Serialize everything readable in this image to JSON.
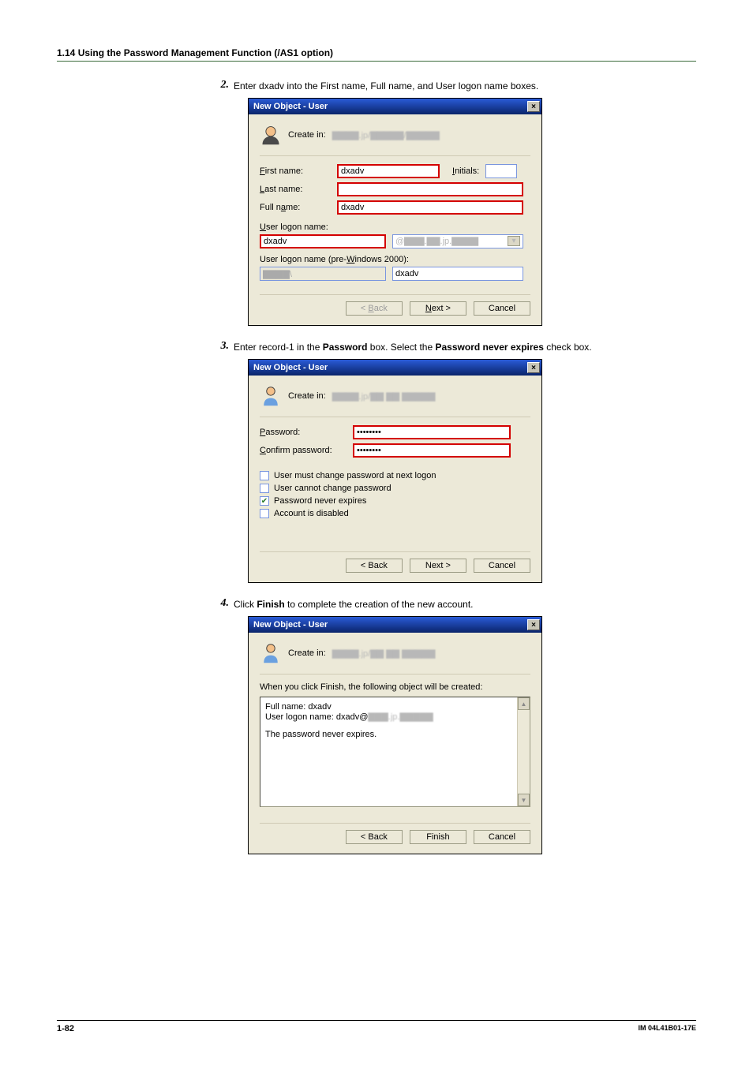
{
  "heading": "1.14  Using the Password Management Function (/AS1 option)",
  "steps": {
    "s2": {
      "num": "2.",
      "text": "Enter dxadv into the First name, Full name, and User logon name boxes."
    },
    "s3": {
      "num": "3.",
      "text_pre": "Enter record-1 in the ",
      "bold1": "Password",
      "mid": " box. Select the ",
      "bold2": "Password never expires",
      "text_post": " check box."
    },
    "s4": {
      "num": "4.",
      "text_pre": "Click ",
      "bold1": "Finish",
      "text_post": " to complete the creation of the new account."
    }
  },
  "dialog1": {
    "title": "New Object - User",
    "create_in_label": "Create in:",
    "create_in_path": "▇▇▇▇.jp/▇▇▇▇▇/▇▇▇▇▇",
    "first_name_label": "First name:",
    "first_name_value": "dxadv",
    "initials_label": "Initials:",
    "last_name_label": "Last name:",
    "full_name_label": "Full name:",
    "full_name_value": "dxadv",
    "user_logon_label": "User logon name:",
    "user_logon_value": "dxadv",
    "domain_value": "@▇▇▇.▇▇.jp.▇▇▇▇",
    "pre2000_label": "User logon name (pre-Windows 2000):",
    "pre2000_prefix": "▇▇▇▇\\",
    "pre2000_value": "dxadv",
    "btn_back": "< Back",
    "btn_next": "Next >",
    "btn_cancel": "Cancel"
  },
  "dialog2": {
    "title": "New Object - User",
    "create_in_label": "Create in:",
    "create_in_path": "▇▇▇▇.jp/▇▇ ▇▇ ▇▇▇▇▇",
    "password_label": "Password:",
    "password_value": "••••••••",
    "confirm_label": "Confirm password:",
    "confirm_value": "••••••••",
    "chk_mustchange": "User must change password at next logon",
    "chk_cannot": "User cannot change password",
    "chk_never": "Password never expires",
    "chk_disabled": "Account is disabled",
    "btn_back": "< Back",
    "btn_next": "Next >",
    "btn_cancel": "Cancel"
  },
  "dialog3": {
    "title": "New Object - User",
    "create_in_label": "Create in:",
    "create_in_path": "▇▇▇▇.jp/▇▇ ▇▇ ▇▇▇▇▇",
    "intro": "When you click Finish, the following object will be created:",
    "line1": "Full name: dxadv",
    "line2_pre": "User logon name: dxadv@",
    "line2_dom": "▇▇▇.jp.▇▇▇▇▇",
    "line3": "The password never expires.",
    "btn_back": "< Back",
    "btn_finish": "Finish",
    "btn_cancel": "Cancel"
  },
  "footer": {
    "page": "1-82",
    "doc": "IM 04L41B01-17E"
  }
}
